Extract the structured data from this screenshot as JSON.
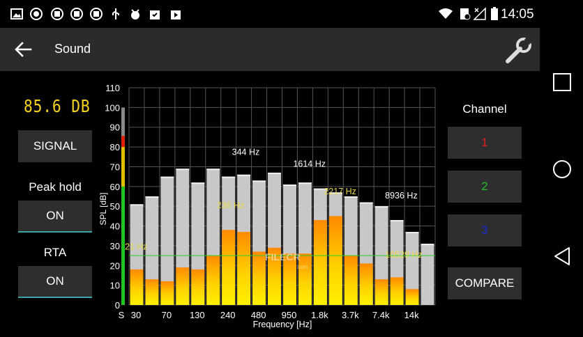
{
  "status": {
    "time": "14:05"
  },
  "app": {
    "title": "Sound"
  },
  "readout": {
    "value": "85.6 DB"
  },
  "controls": {
    "signal_label": "SIGNAL",
    "peak_hold_label": "Peak hold",
    "peak_hold_value": "ON",
    "rta_label": "RTA",
    "rta_value": "ON"
  },
  "channels": {
    "title": "Channel",
    "items": [
      {
        "label": "1",
        "color": "#e02020"
      },
      {
        "label": "2",
        "color": "#22c02a"
      },
      {
        "label": "3",
        "color": "#1a2ad6"
      }
    ],
    "compare_label": "COMPARE"
  },
  "watermark": {
    "text": "FILECR",
    "sub": ".com"
  },
  "chart_data": {
    "type": "bar",
    "ylabel": "SPL [dB]",
    "xlabel": "Frequency [Hz]",
    "ylim": [
      0,
      110
    ],
    "yticks": [
      0,
      10,
      20,
      30,
      40,
      50,
      60,
      70,
      80,
      90,
      100,
      110
    ],
    "xtick_labels": [
      "S",
      "30",
      "70",
      "130",
      "240",
      "480",
      "950",
      "1.8k",
      "3.7k",
      "7.4k",
      "14k"
    ],
    "grid": true,
    "reference_line": 25,
    "level_meter": 85.6,
    "series": [
      {
        "name": "peak",
        "values": [
          51,
          55,
          65,
          69,
          62,
          69,
          65,
          66,
          63,
          67,
          61,
          62,
          59,
          57,
          55,
          52,
          50,
          43,
          37,
          31
        ]
      },
      {
        "name": "current",
        "values": [
          18,
          13,
          12,
          19,
          18,
          25,
          38,
          37,
          27,
          29,
          26,
          26,
          43,
          45,
          25,
          21,
          13,
          14,
          8,
          0
        ]
      }
    ],
    "annotations": [
      {
        "text": "21 Hz",
        "x_bar": 0,
        "y": 28,
        "color": "#e8d84a"
      },
      {
        "text": "236 Hz",
        "x_bar": 6,
        "y": 49,
        "color": "#e8d84a"
      },
      {
        "text": "344 Hz",
        "x_bar": 7,
        "y": 76,
        "color": "#ffffff"
      },
      {
        "text": "1614 Hz",
        "x_bar": 11,
        "y": 70,
        "color": "#ffffff"
      },
      {
        "text": "2217 Hz",
        "x_bar": 13,
        "y": 56,
        "color": "#e8d84a"
      },
      {
        "text": "8936 Hz",
        "x_bar": 17,
        "y": 54,
        "color": "#ffffff"
      },
      {
        "text": "10529 Hz",
        "x_bar": 17,
        "y": 24,
        "color": "#e8d84a"
      }
    ]
  }
}
